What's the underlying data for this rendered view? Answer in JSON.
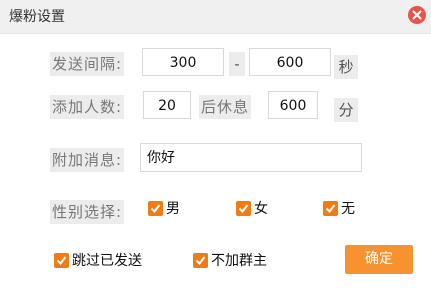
{
  "window": {
    "title": "爆粉设置"
  },
  "send_interval": {
    "label": "发送间隔:",
    "min": "300",
    "separator": "-",
    "max": "600",
    "unit": "秒"
  },
  "add_people": {
    "label": "添加人数:",
    "count": "20",
    "rest_label": "后休息",
    "rest_value": "600",
    "unit": "分"
  },
  "attach_message": {
    "label": "附加消息:",
    "value": "你好"
  },
  "gender": {
    "label": "性别选择:",
    "options": [
      {
        "label": "男",
        "checked": true
      },
      {
        "label": "女",
        "checked": true
      },
      {
        "label": "无",
        "checked": true
      }
    ]
  },
  "options": {
    "skip_sent": {
      "label": "跳过已发送",
      "checked": true
    },
    "no_group_owner": {
      "label": "不加群主",
      "checked": true
    }
  },
  "buttons": {
    "confirm": "确定"
  },
  "colors": {
    "accent": "#f07c16",
    "button": "#f7932f",
    "close": "#e8534a"
  },
  "icons": {
    "close": "close-icon",
    "check": "checkmark-icon"
  }
}
